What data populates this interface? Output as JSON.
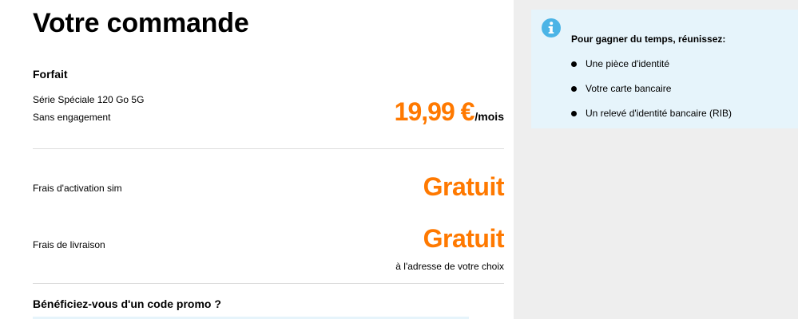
{
  "order": {
    "title": "Votre commande",
    "plan": {
      "section_title": "Forfait",
      "name": "Série Spéciale 120 Go 5G",
      "commitment": "Sans engagement",
      "price": "19,99 €",
      "price_unit": "/mois"
    },
    "activation": {
      "label": "Frais d'activation sim",
      "value": "Gratuit"
    },
    "delivery": {
      "label": "Frais de livraison",
      "value": "Gratuit",
      "note": "à l'adresse de votre choix"
    },
    "promo": {
      "label": "Bénéficiez-vous d'un code promo ?"
    }
  },
  "info": {
    "icon": "info-icon",
    "title": "Pour gagner du temps, réunissez:",
    "items": [
      "Une pièce d'identité",
      "Votre carte bancaire",
      "Un relevé d'identité bancaire (RIB)"
    ]
  },
  "colors": {
    "accent": "#ff7900",
    "info_background": "#e6f4fb",
    "info_icon": "#4bb4e6",
    "sidebar_background": "#eeeeee"
  }
}
